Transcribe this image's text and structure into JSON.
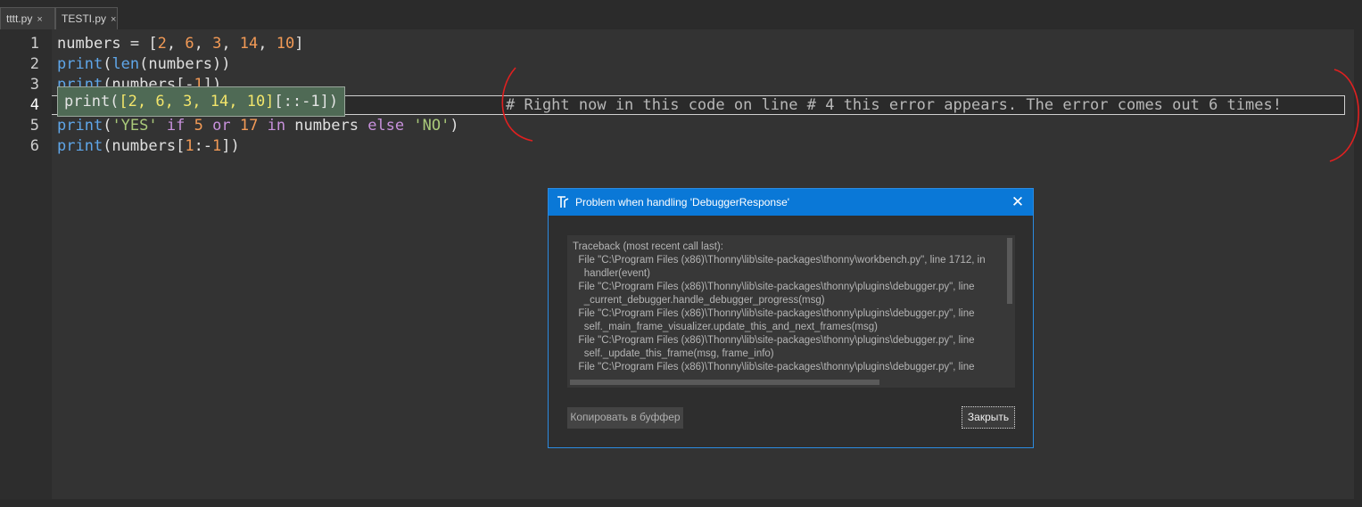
{
  "tabs": [
    {
      "label": "tttt.py",
      "close": "×"
    },
    {
      "label": "TESTI.py",
      "close": "×"
    }
  ],
  "editor": {
    "line_numbers": [
      "1",
      "2",
      "3",
      "4",
      "5",
      "6"
    ],
    "line1": {
      "a": "numbers = [",
      "n1": "2",
      "c1": ", ",
      "n2": "6",
      "c2": ", ",
      "n3": "3",
      "c3": ", ",
      "n4": "14",
      "c4": ", ",
      "n5": "10",
      "e": "]"
    },
    "line2": {
      "p": "print",
      "a": "(",
      "f": "len",
      "b": "(numbers))"
    },
    "line3": {
      "p": "print",
      "a": "(numbers[-",
      "n": "1",
      "b": "])"
    },
    "line5": {
      "p": "print",
      "a": "(",
      "s1": "'YES'",
      "b": " ",
      "k1": "if",
      "c": " ",
      "n1": "5",
      "d": " ",
      "k2": "or",
      "e": " ",
      "n2": "17",
      "f": " ",
      "k3": "in",
      "g": " numbers ",
      "k4": "else",
      "h": " ",
      "s2": "'NO'",
      "i": ")"
    },
    "line6": {
      "p": "print",
      "a": "(numbers[",
      "n1": "1",
      "b": ":-",
      "n2": "1",
      "c": "])"
    },
    "tooltip": {
      "a": "print(",
      "hl": "[2, 6, 3, 14, 10]",
      "b": "[::-1])"
    },
    "comment": "# Right now in this code on line # 4 this error appears. The error comes out 6 times!"
  },
  "dialog": {
    "title": "Problem when handling 'DebuggerResponse'",
    "close": "✕",
    "traceback": [
      "Traceback (most recent call last):",
      "  File \"C:\\Program Files (x86)\\Thonny\\lib\\site-packages\\thonny\\workbench.py\", line 1712, in",
      "    handler(event)",
      "  File \"C:\\Program Files (x86)\\Thonny\\lib\\site-packages\\thonny\\plugins\\debugger.py\", line",
      "    _current_debugger.handle_debugger_progress(msg)",
      "  File \"C:\\Program Files (x86)\\Thonny\\lib\\site-packages\\thonny\\plugins\\debugger.py\", line",
      "    self._main_frame_visualizer.update_this_and_next_frames(msg)",
      "  File \"C:\\Program Files (x86)\\Thonny\\lib\\site-packages\\thonny\\plugins\\debugger.py\", line",
      "    self._update_this_frame(msg, frame_info)",
      "  File \"C:\\Program Files (x86)\\Thonny\\lib\\site-packages\\thonny\\plugins\\debugger.py\", line"
    ],
    "copy_label": "Копировать в буффер",
    "close_label": "Закрыть"
  }
}
